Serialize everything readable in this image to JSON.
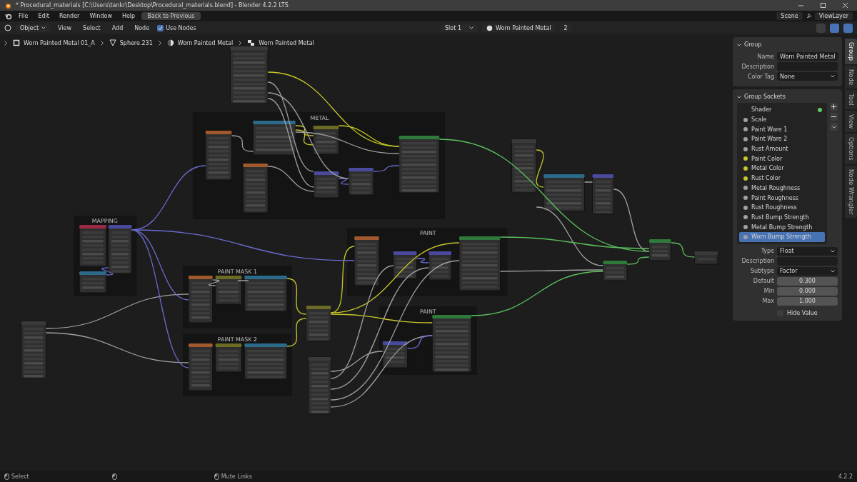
{
  "title_bar": {
    "title": "* Procedural_materials [C:\\Users\\tankr\\Desktop\\Procedural_materials.blend] - Blender 4.2.2 LTS"
  },
  "menu_bar": {
    "menus": [
      "File",
      "Edit",
      "Render",
      "Window",
      "Help"
    ],
    "back_button": "Back to Previous",
    "scene": "Scene",
    "view_layer": "ViewLayer"
  },
  "header": {
    "mode": "Object",
    "menus": [
      "View",
      "Select",
      "Add",
      "Node"
    ],
    "use_nodes": {
      "label": "Use Nodes",
      "checked": true
    },
    "slot": "Slot 1",
    "material": "Worn Painted Metal",
    "users": "2"
  },
  "breadcrumbs": [
    {
      "kind": "object",
      "label": "Worn Painted Metal 01_A"
    },
    {
      "kind": "mesh",
      "label": "Sphere.231"
    },
    {
      "kind": "material",
      "label": "Worn Painted Metal"
    },
    {
      "kind": "group",
      "label": "Worn Painted Metal"
    }
  ],
  "frames": [
    "METAL",
    "MAPPING",
    "PAINT MASK 1",
    "PAINT MASK 2",
    "PAINT",
    "PAINT"
  ],
  "sidebar": {
    "group": {
      "title": "Group",
      "fields": [
        {
          "kind": "text",
          "label": "Name",
          "value": "Worn Painted Metal"
        },
        {
          "kind": "text",
          "label": "Description"
        },
        {
          "kind": "dropdown",
          "label": "Color Tag",
          "value": "None"
        }
      ]
    },
    "sockets": {
      "title": "Group Sockets",
      "items": [
        {
          "kind": "output",
          "name": "Shader",
          "color": "#63c763",
          "selected": false
        },
        {
          "kind": "input",
          "name": "Scale",
          "color": "#a1a1a1",
          "selected": false
        },
        {
          "kind": "input",
          "name": "Paint Ware 1",
          "color": "#a1a1a1",
          "selected": false
        },
        {
          "kind": "input",
          "name": "Paint Ware 2",
          "color": "#a1a1a1",
          "selected": false
        },
        {
          "kind": "input",
          "name": "Rust Amount",
          "color": "#a1a1a1",
          "selected": false
        },
        {
          "kind": "input",
          "name": "Paint Color",
          "color": "#c7c729",
          "selected": false
        },
        {
          "kind": "input",
          "name": "Metal Color",
          "color": "#c7c729",
          "selected": false
        },
        {
          "kind": "input",
          "name": "Rust Color",
          "color": "#c7c729",
          "selected": false
        },
        {
          "kind": "input",
          "name": "Metal Roughness",
          "color": "#a1a1a1",
          "selected": false
        },
        {
          "kind": "input",
          "name": "Paint Roughness",
          "color": "#a1a1a1",
          "selected": false
        },
        {
          "kind": "input",
          "name": "Rust Roughness",
          "color": "#a1a1a1",
          "selected": false
        },
        {
          "kind": "input",
          "name": "Rust Bump Strength",
          "color": "#a1a1a1",
          "selected": false
        },
        {
          "kind": "input",
          "name": "Metal Bump Strength",
          "color": "#a1a1a1",
          "selected": false
        },
        {
          "kind": "input",
          "name": "Worn Bump Strength",
          "color": "#a1a1a1",
          "selected": true
        }
      ],
      "properties": [
        {
          "kind": "dropdown",
          "label": "Type",
          "value": "Float"
        },
        {
          "kind": "text",
          "label": "Description"
        },
        {
          "kind": "dropdown",
          "label": "Subtype",
          "value": "Factor"
        },
        {
          "kind": "number",
          "label": "Default",
          "value": "0.300"
        },
        {
          "kind": "number",
          "label": "Min",
          "value": "0.000"
        },
        {
          "kind": "number",
          "label": "Max",
          "value": "1.000"
        }
      ],
      "hide_value": {
        "label": "Hide Value",
        "checked": false
      }
    }
  },
  "side_tabs": [
    {
      "label": "Group",
      "selected": true
    },
    {
      "label": "Node",
      "selected": false
    },
    {
      "label": "Tool",
      "selected": false
    },
    {
      "label": "View",
      "selected": false
    },
    {
      "label": "Options",
      "selected": false
    },
    {
      "label": "Node Wrangler",
      "selected": false
    }
  ],
  "status_bar": {
    "items": [
      "Select",
      "Mute Links"
    ],
    "version": "4.2.2"
  }
}
